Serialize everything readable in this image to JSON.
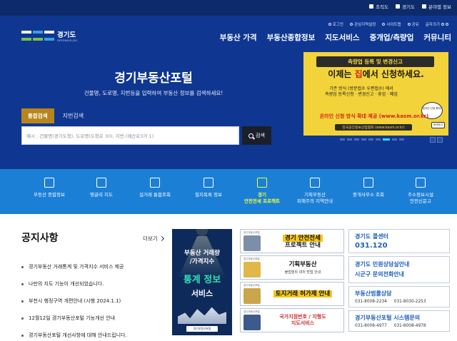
{
  "topbar": {
    "links": [
      {
        "label": "조직도",
        "icon": "org-chart-icon"
      },
      {
        "label": "경기도",
        "icon": "gyeonggi-icon"
      },
      {
        "label": "분야별 정보",
        "icon": "grid-icon"
      }
    ]
  },
  "header": {
    "logo_name": "경기도",
    "logo_sub": "GYEONGGI-DO",
    "util": [
      "로그인",
      "관심지역설정",
      "사이트맵",
      "공유",
      "글자크기"
    ],
    "nav": [
      "부동산 가격",
      "부동산종합정보",
      "지도서비스",
      "중개업/측량업",
      "커뮤니티"
    ]
  },
  "hero": {
    "title": "경기부동산포털",
    "subtitle": "건물명, 도로명, 지번등을 입력하여 부동산 정보를 검색하세요!",
    "tab_active": "통합검색",
    "tab_other": "지번검색",
    "search_placeholder": "예시 : 건물명(경기도청), 도로명(도청로 30), 지번 (매산로3가 1)",
    "search_button": "검색"
  },
  "banner": {
    "line1": "측량업 등록 및 변경신고",
    "line2_pre": "이제는 ",
    "line2_red": "집",
    "line2_post": "에서 신청하세요.",
    "line3a": "기존 방식 (방문접수 우편접수) 에서",
    "line3b": "측량업 등록신청 · 변경신고 · 휴업 · 폐업",
    "line4": "온라인 신청 방식 확대 제공 (www.kasm.or.kr)",
    "line5": "한국공간정보산업협회 (www.kasm.or.kr)",
    "badge": "온라인 신청 확대!",
    "tag": "문의하기"
  },
  "slider": {
    "dots": 9,
    "active": 6
  },
  "quick_menu": [
    {
      "label1": "부동산 종합정보",
      "label2": "",
      "icon": "house-icon"
    },
    {
      "label1": "맹글리 지도",
      "label2": "",
      "icon": "map-doc-icon"
    },
    {
      "label1": "실거래 통합조회",
      "label2": "",
      "icon": "chart-search-icon"
    },
    {
      "label1": "필지목록 정보",
      "label2": "",
      "icon": "list-icon"
    },
    {
      "label1": "경기",
      "label2": "안전전세 프로젝트",
      "icon": "safe-building-icon"
    },
    {
      "label1": "기획부동산",
      "label2": "피해주의 지역안내",
      "icon": "warning-map-icon"
    },
    {
      "label1": "중개사무소 조회",
      "label2": "",
      "icon": "office-icon"
    },
    {
      "label1": "주소정보시설",
      "label2": "안전신문고",
      "icon": "signpost-icon"
    }
  ],
  "notices": {
    "title": "공지사항",
    "more": "더보기",
    "items": [
      "경기부동산 거래통계 및 가격지수 서비스 제공",
      "나만의 지도 기능이 개선되었습니다.",
      "부천시 행정구역 개편안내 (시행 2024.1.1)",
      "12월12일 경기부동산포털 기능개선 안내",
      "경기부동산포털 개선사항에 대해 안내드립니다."
    ]
  },
  "promo": {
    "line1": "부동산 거래량",
    "line1b": "/가격지수",
    "line2": "통계 정보",
    "line3": "서비스",
    "footer": "경기부동산포털"
  },
  "cards": [
    {
      "top": "경기부동산포털",
      "title": "경기 안전전세",
      "title2": "프로젝트 안내",
      "sub": "",
      "thumb_color": "#7d8fa8"
    },
    {
      "top": "경기부동산포털",
      "title": "기획부동산",
      "title2": "",
      "sub": "불법행위 대처 방법 안내",
      "thumb_color": "#e0b84a"
    },
    {
      "top": "경기부동산포털",
      "title": "토지거래 허가제 안내",
      "title2": "",
      "sub": "",
      "thumb_color": "#c9a64a"
    },
    {
      "top": "경기부동산포털",
      "title": "국가지점번호 / 지형도",
      "title2": "지도서비스",
      "sub": "",
      "thumb_color": "#3d5a8c"
    }
  ],
  "contacts": {
    "call_label": "경기도 콜센터",
    "call_number": "031.120",
    "civil_line1": "경기도 민원상담실안내",
    "civil_line2": "시군구 문의전화안내",
    "fraud_label": "부동산범률상담",
    "fraud_nums": [
      "031-8008-2234",
      "031-8030-2253"
    ],
    "sys_label": "경기부동산포털 시스템문의",
    "sys_nums": [
      "031-8008-4977",
      "031-8008-4978"
    ]
  },
  "colors": {
    "hero_bg": "#0f3791",
    "quick_bg": "#1c7fd6",
    "accent_gold": "#b8851b",
    "highlight": "#e8ff3a"
  }
}
